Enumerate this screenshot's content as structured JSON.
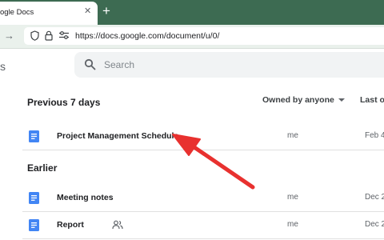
{
  "browser": {
    "tab": {
      "title": "ogle Docs",
      "close_glyph": "✕"
    },
    "new_tab_glyph": "+",
    "address": {
      "url": "https://docs.google.com/document/u/0/"
    }
  },
  "app": {
    "title_fragment": "s",
    "search": {
      "placeholder": "Search"
    }
  },
  "filters": {
    "owner": "Owned by anyone",
    "sort": "Last op"
  },
  "sections": [
    {
      "label": "Previous 7 days",
      "rows": [
        {
          "title": "Project Management Schedule",
          "owner": "me",
          "date": "Feb 4"
        }
      ]
    },
    {
      "label": "Earlier",
      "rows": [
        {
          "title": "Meeting notes",
          "owner": "me",
          "date": "Dec 2"
        },
        {
          "title": "Report",
          "owner": "me",
          "date": "Dec 2",
          "shared": true
        }
      ]
    }
  ],
  "colors": {
    "tabstrip": "#3d6b52",
    "docs_blue": "#4285f4",
    "annotation_red": "#e8312f"
  }
}
